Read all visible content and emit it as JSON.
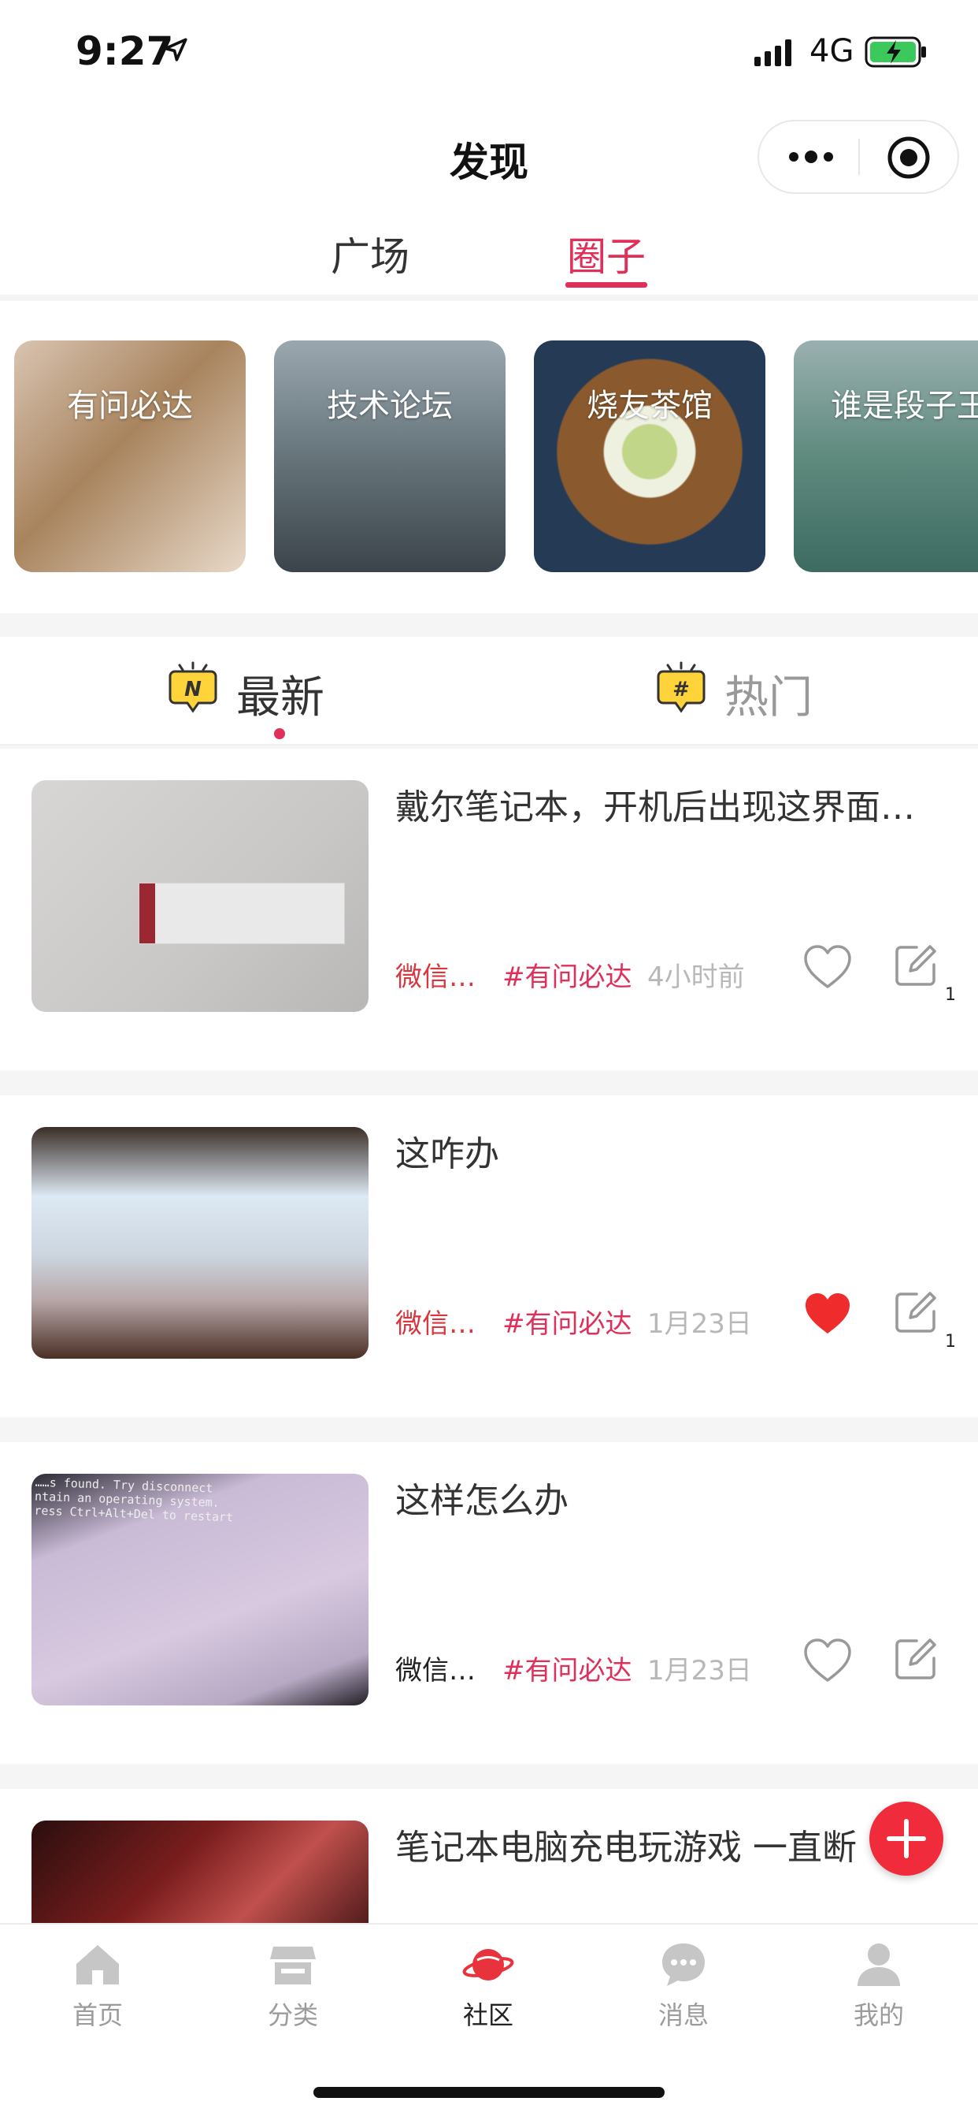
{
  "status_bar": {
    "time": "9:27",
    "network": "4G"
  },
  "nav": {
    "title": "发现"
  },
  "top_tabs": [
    {
      "label": "广场",
      "active": false
    },
    {
      "label": "圈子",
      "active": true
    }
  ],
  "circles": [
    {
      "label": "有问必达"
    },
    {
      "label": "技术论坛"
    },
    {
      "label": "烧友茶馆"
    },
    {
      "label": "谁是段子王"
    }
  ],
  "sort_tabs": [
    {
      "label": "最新",
      "active": true
    },
    {
      "label": "热门",
      "active": false
    }
  ],
  "posts": [
    {
      "title": "戴尔笔记本，开机后出现这界面…",
      "source": "微信…",
      "tag": "#有问必达",
      "time": "4小时前",
      "liked": false,
      "comments": "1"
    },
    {
      "title": "这咋办",
      "source": "微信…",
      "tag": "#有问必达",
      "time": "1月23日",
      "liked": true,
      "comments": "1"
    },
    {
      "title": "这样怎么办",
      "source": "微信…",
      "tag": "#有问必达",
      "time": "1月23日",
      "liked": false,
      "comments": ""
    },
    {
      "title": "笔记本电脑充电玩游戏 一直断",
      "source": "",
      "tag": "",
      "time": "",
      "liked": false,
      "comments": ""
    }
  ],
  "post3_thumb_text": "ntain an operating system.\nress Ctrl+Alt+Del to restart",
  "post3_thumb_text_top": "……s found. Try disconnect",
  "tab_bar": [
    {
      "label": "首页",
      "icon": "home-icon",
      "active": false
    },
    {
      "label": "分类",
      "icon": "store-icon",
      "active": false
    },
    {
      "label": "社区",
      "icon": "planet-icon",
      "active": true
    },
    {
      "label": "消息",
      "icon": "chat-icon",
      "active": false
    },
    {
      "label": "我的",
      "icon": "user-icon",
      "active": false
    }
  ],
  "colors": {
    "accent": "#e0305a",
    "fab": "#ef2b3c",
    "liked": "#f02b2b"
  }
}
